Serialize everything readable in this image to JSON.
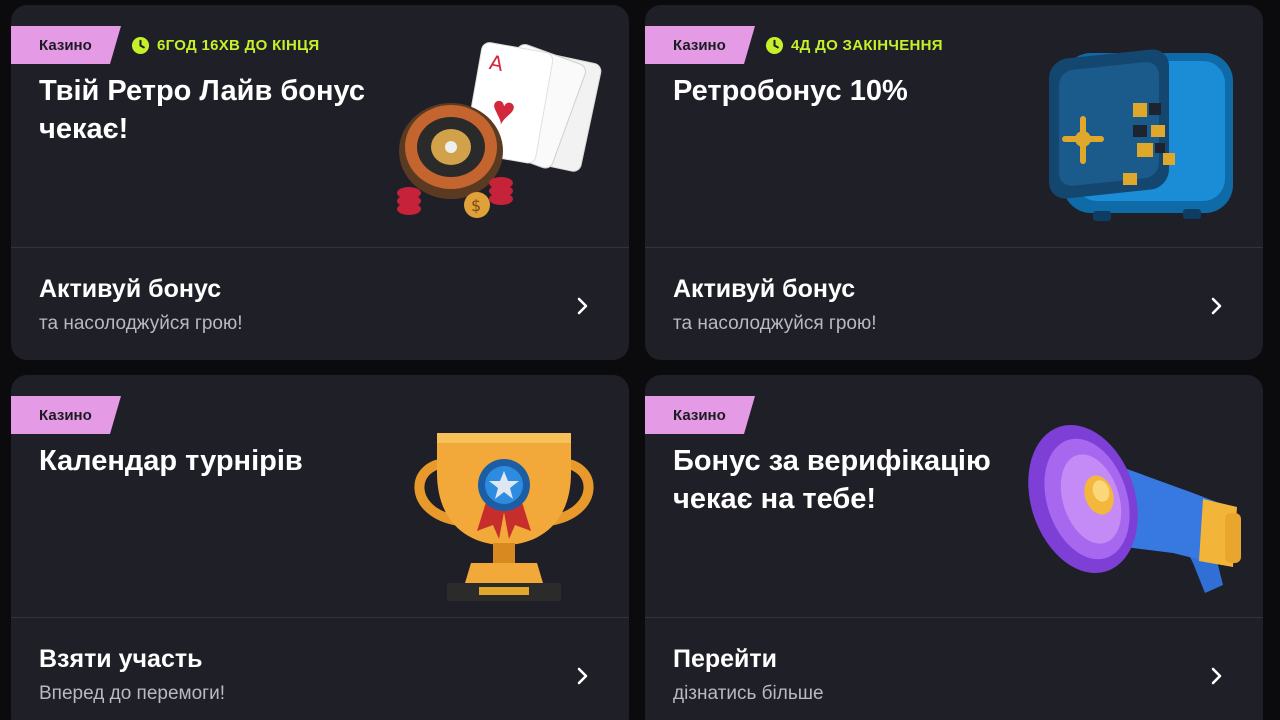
{
  "cards": [
    {
      "tag": "Казино",
      "timer": "6ГОД 16ХВ ДО КІНЦЯ",
      "title": "Твій Ретро Лайв бонус чекає!",
      "footer_title": "Активуй бонус",
      "footer_sub": "та насолоджуйся грою!",
      "image": "roulette-cards-icon"
    },
    {
      "tag": "Казино",
      "timer": "4Д ДО ЗАКІНЧЕННЯ",
      "title": "Ретробонус 10%",
      "footer_title": "Активуй бонус",
      "footer_sub": "та насолоджуйся грою!",
      "image": "safe-icon"
    },
    {
      "tag": "Казино",
      "title": "Календар турнірів",
      "footer_title": "Взяти участь",
      "footer_sub": "Вперед до перемоги!",
      "image": "trophy-icon"
    },
    {
      "tag": "Казино",
      "title": "Бонус за верифікацію чекає на тебе!",
      "footer_title": "Перейти",
      "footer_sub": "дізнатись більше",
      "image": "megaphone-icon"
    }
  ],
  "colors": {
    "tag": "#e49ae4",
    "timer": "#c6f02a",
    "card": "#1f1f27",
    "background": "#0b0b0d"
  }
}
